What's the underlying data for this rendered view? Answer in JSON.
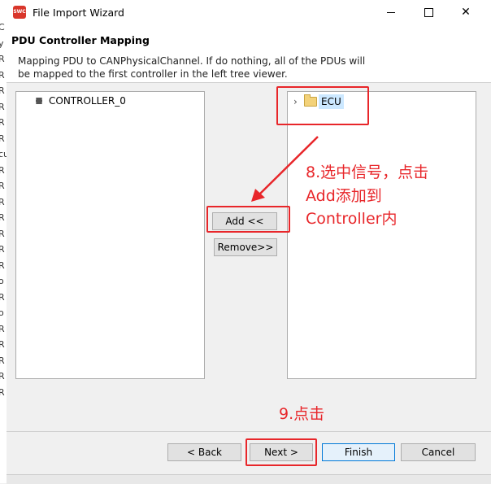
{
  "window": {
    "title": "File Import Wizard",
    "app_icon_text": "SWC",
    "minimize_label": "—",
    "maximize_label": "☐",
    "close_label": "✕"
  },
  "header": {
    "page_title": "PDU Controller Mapping",
    "description": "Mapping PDU to CANPhysicalChannel. If do nothing, all of the PDUs will be mapped to the first controller in the left tree viewer."
  },
  "left_tree": {
    "items": [
      {
        "label": "CONTROLLER_0",
        "icon": "controller-node-icon"
      }
    ]
  },
  "right_tree": {
    "items": [
      {
        "label": "ECU",
        "icon": "folder-icon",
        "expandable": true,
        "selected": true
      }
    ]
  },
  "mapping_buttons": {
    "add_label": "Add <<",
    "remove_label": "Remove>>"
  },
  "footer": {
    "back_label": "< Back",
    "next_label": "Next >",
    "finish_label": "Finish",
    "cancel_label": "Cancel"
  },
  "annotations": {
    "step8_line1": "8.选中信号，点击",
    "step8_line2": "Add添加到",
    "step8_line3": "Controller内",
    "step9": "9.点击",
    "color": "#e8262a"
  },
  "background_window": {
    "edge_chars": [
      "C",
      "y",
      "R",
      "R",
      "R",
      "R",
      "R",
      "R",
      "cu",
      "R",
      "R",
      "R",
      "R",
      "R",
      "R",
      "R",
      "o",
      "R",
      "o",
      "R",
      "R",
      "R",
      "R",
      "R"
    ]
  }
}
